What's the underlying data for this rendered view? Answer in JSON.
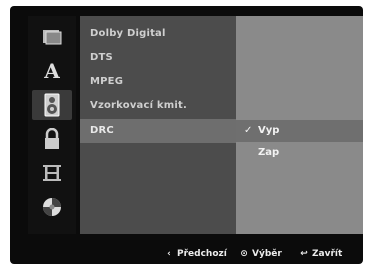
{
  "sidebar": {
    "items": [
      {
        "icon": "disc-icon"
      },
      {
        "icon": "language-icon",
        "glyph": "A"
      },
      {
        "icon": "audio-icon"
      },
      {
        "icon": "lock-icon"
      },
      {
        "icon": "film-icon"
      },
      {
        "icon": "other-settings-icon"
      }
    ],
    "active_index": 2
  },
  "menu": {
    "items": [
      {
        "label": "Dolby Digital"
      },
      {
        "label": "DTS"
      },
      {
        "label": "MPEG"
      },
      {
        "label": "Vzorkovací kmit."
      },
      {
        "label": "DRC"
      }
    ],
    "selected_index": 4
  },
  "submenu": {
    "items": [
      {
        "label": "Vyp",
        "checked": true
      },
      {
        "label": "Zap",
        "checked": false
      }
    ],
    "check_glyph": "✓"
  },
  "footer": {
    "prev": {
      "glyph": "‹",
      "label": "Předchozí"
    },
    "select": {
      "glyph": "⊙",
      "label": "Výběr"
    },
    "close": {
      "glyph": "↩",
      "label": "Zavřít"
    }
  },
  "colors": {
    "background": "#0b0b0b",
    "menu_bg": "#4c4c4c",
    "menu_selected": "#6e6e6e",
    "submenu_bg": "#8a8a8a",
    "submenu_selected": "#6f6f6f"
  }
}
